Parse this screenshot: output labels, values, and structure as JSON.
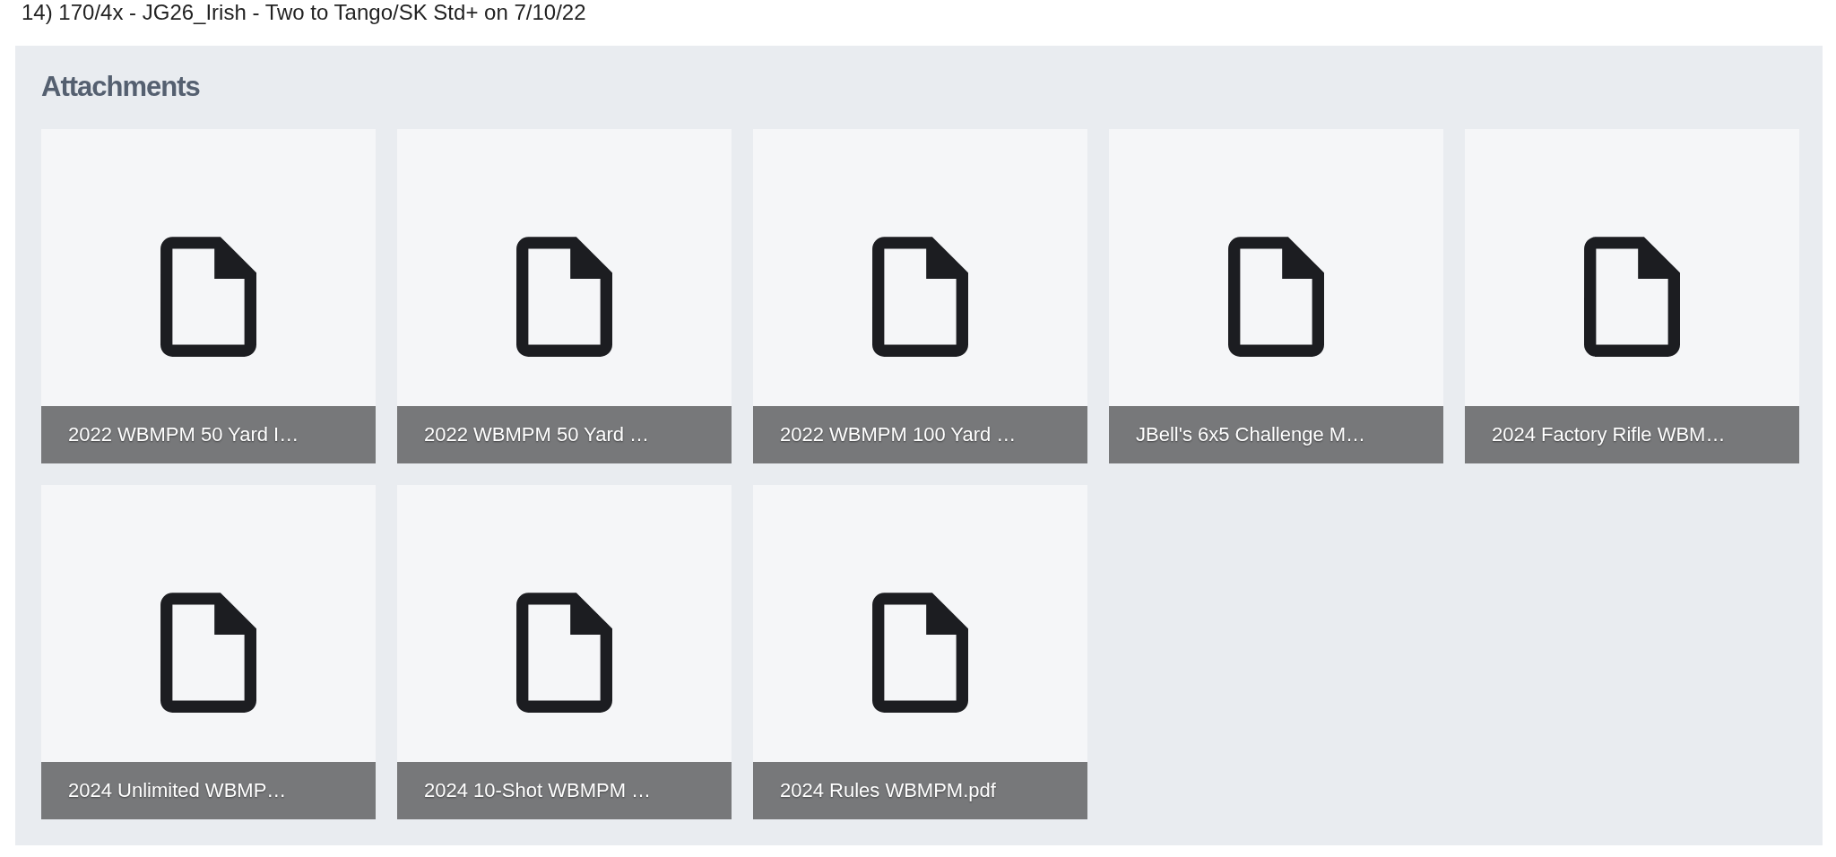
{
  "heading_line": "14) 170/4x - JG26_Irish - Two to Tango/SK Std+ on 7/10/22",
  "attachments": {
    "title": "Attachments",
    "files": [
      {
        "name": "2022 WBMPM 50 Yard I…"
      },
      {
        "name": "2022 WBMPM 50 Yard …"
      },
      {
        "name": "2022 WBMPM 100 Yard …"
      },
      {
        "name": "JBell's 6x5 Challenge M…"
      },
      {
        "name": "2024 Factory Rifle WBM…"
      },
      {
        "name": "2024 Unlimited WBMP…"
      },
      {
        "name": "2024 10-Shot WBMPM …"
      },
      {
        "name": "2024 Rules WBMPM.pdf"
      }
    ]
  }
}
